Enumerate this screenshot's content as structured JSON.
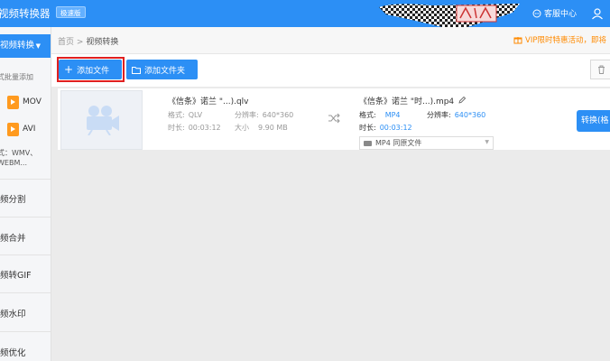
{
  "app": {
    "title": "视频转换器",
    "badge": "极速版",
    "service": "客服中心"
  },
  "sidebar": {
    "active": "视频转换",
    "batch": "式批量添加",
    "formats": [
      "MOV",
      "AVI"
    ],
    "other_line1": "式：WMV、",
    "other_line2": "WEBM...",
    "items": [
      "频分割",
      "频合并",
      "频转GIF",
      "频水印",
      "频优化"
    ]
  },
  "breadcrumb": {
    "home": "首页",
    "sep": ">",
    "current": "视频转换"
  },
  "promo": "VIP限时特惠活动，即将",
  "toolbar": {
    "add_file": "添加文件",
    "add_folder": "添加文件夹"
  },
  "file": {
    "source_name": "《信条》诺兰 \"...).qlv",
    "format_label": "格式:",
    "format_value": "QLV",
    "resolution_label": "分辨率:",
    "resolution_value": "640*360",
    "duration_label": "时长:",
    "duration_value": "00:03:12",
    "size_label": "大小",
    "size_value": "9.90 MB",
    "target_name": "《信条》诺兰 \"时...).mp4",
    "target_format_label": "格式:",
    "target_format_value": "MP4",
    "target_resolution_label": "分辨率:",
    "target_resolution_value": "640*360",
    "target_duration_label": "时长:",
    "target_duration_value": "00:03:12",
    "output_preset": "MP4  同原文件",
    "convert_label": "转换(格"
  },
  "colors": {
    "accent": "#2c8ff5",
    "promo": "#ff8a00",
    "highlight": "#e02020",
    "format_icon": "#ff9a1f"
  },
  "icons": [
    "chat-icon",
    "user-icon",
    "chevron-down-icon",
    "play-icon",
    "plus-icon",
    "folder-icon",
    "trash-icon",
    "video-camera-icon",
    "shuffle-arrow-icon",
    "pencil-icon",
    "gift-icon"
  ]
}
